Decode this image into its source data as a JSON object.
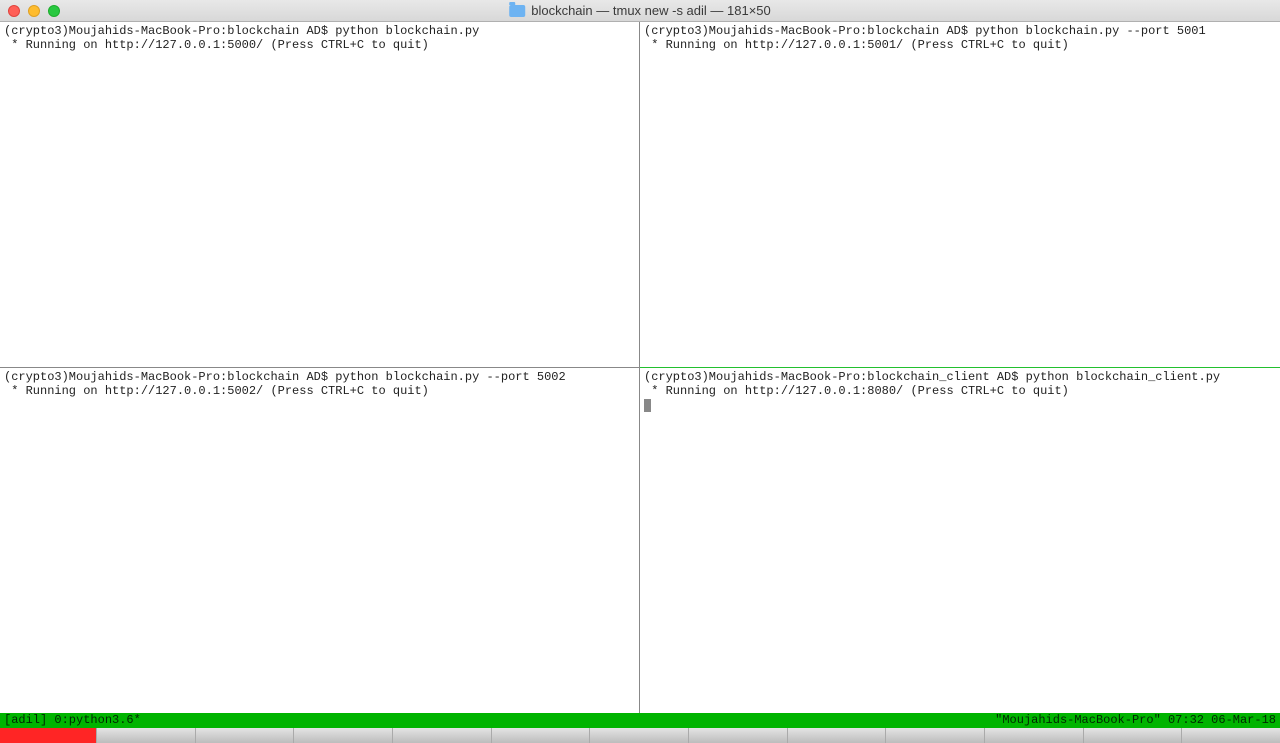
{
  "window": {
    "title": "blockchain — tmux new -s adil — 181×50"
  },
  "panes": {
    "top_left": {
      "line1": "(crypto3)Moujahids-MacBook-Pro:blockchain AD$ python blockchain.py",
      "line2": " * Running on http://127.0.0.1:5000/ (Press CTRL+C to quit)"
    },
    "top_right": {
      "line1": "(crypto3)Moujahids-MacBook-Pro:blockchain AD$ python blockchain.py --port 5001",
      "line2": " * Running on http://127.0.0.1:5001/ (Press CTRL+C to quit)"
    },
    "bottom_left": {
      "line1": "(crypto3)Moujahids-MacBook-Pro:blockchain AD$ python blockchain.py --port 5002",
      "line2": " * Running on http://127.0.0.1:5002/ (Press CTRL+C to quit)"
    },
    "bottom_right": {
      "line1": "(crypto3)Moujahids-MacBook-Pro:blockchain_client AD$ python blockchain_client.py",
      "line2": " * Running on http://127.0.0.1:8080/ (Press CTRL+C to quit)"
    }
  },
  "statusbar": {
    "left": "[adil] 0:python3.6*",
    "right": "\"Moujahids-MacBook-Pro\" 07:32 06-Mar-18"
  }
}
